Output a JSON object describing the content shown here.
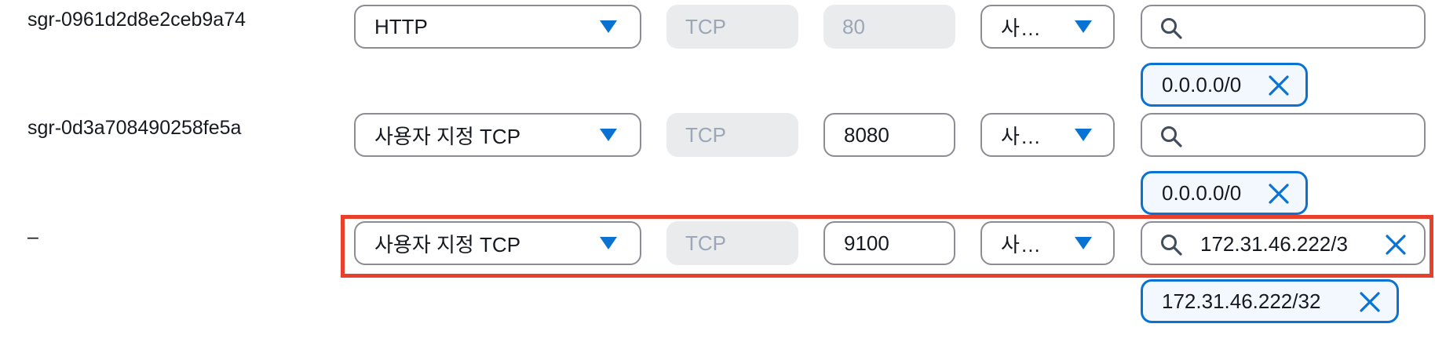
{
  "rules": [
    {
      "rule_id": "sgr-0961d2d8e2ceb9a74",
      "type": "HTTP",
      "protocol": "TCP",
      "port_range": "80",
      "source_type": "사…",
      "search_value": "",
      "source_tokens": [
        "0.0.0.0/0"
      ]
    },
    {
      "rule_id": "sgr-0d3a708490258fe5a",
      "type": "사용자 지정 TCP",
      "protocol": "TCP",
      "port_range": "8080",
      "source_type": "사…",
      "search_value": "",
      "source_tokens": [
        "0.0.0.0/0"
      ]
    },
    {
      "rule_id": "–",
      "type": "사용자 지정 TCP",
      "protocol": "TCP",
      "port_range": "9100",
      "source_type": "사…",
      "search_value": "172.31.46.222/3",
      "source_tokens": [
        "172.31.46.222/32"
      ]
    }
  ],
  "icons": {
    "dropdown": "caret-down-icon",
    "search": "search-icon",
    "clear": "close-icon",
    "remove_token": "close-icon"
  },
  "colors": {
    "accent": "#0972d3",
    "highlight": "#e8402a",
    "disabled_bg": "#e9ebed",
    "disabled_text": "#9ba7b6",
    "token_bg": "#f2f8fd"
  }
}
